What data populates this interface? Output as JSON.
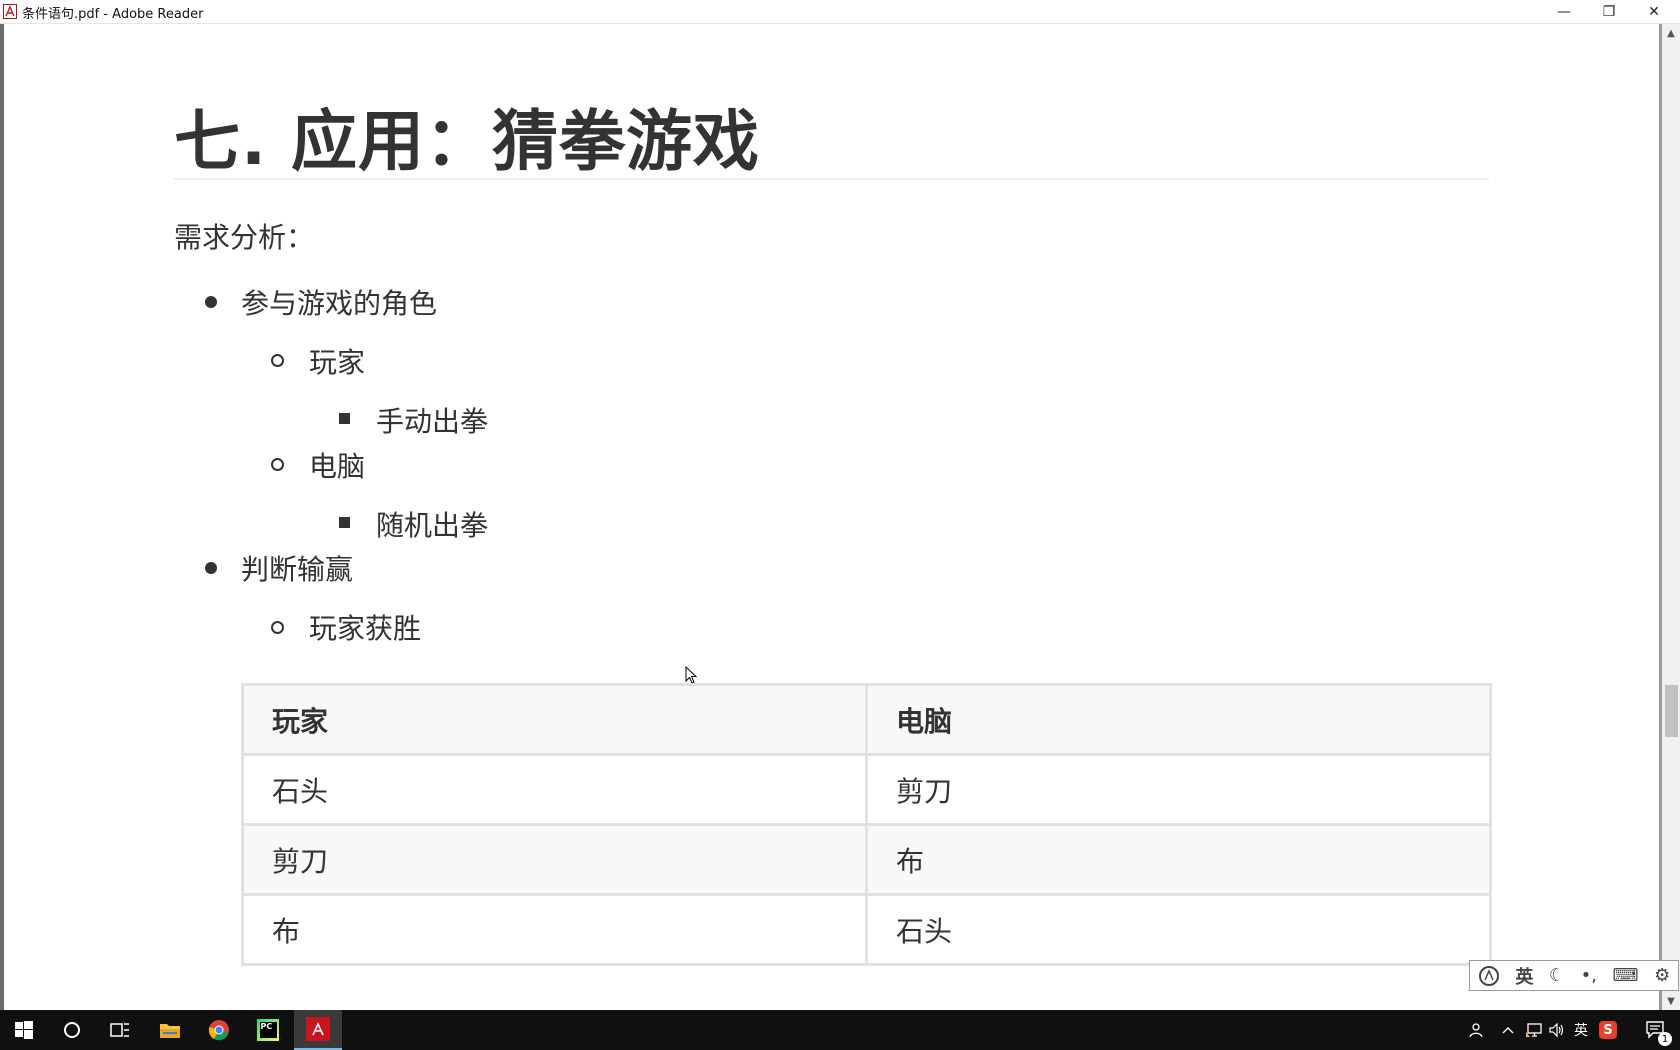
{
  "window": {
    "title": "条件语句.pdf - Adobe Reader",
    "controls": {
      "minimize": "—",
      "restore": "❐",
      "close": "✕"
    }
  },
  "document": {
    "heading": "七. 应用：猜拳游戏",
    "intro": "需求分析：",
    "list": {
      "roles": "参与游戏的角色",
      "player": "玩家",
      "player_action": "手动出拳",
      "computer": "电脑",
      "computer_action": "随机出拳",
      "judge": "判断输赢",
      "player_wins": "玩家获胜"
    },
    "table": {
      "headers": [
        "玩家",
        "电脑"
      ],
      "rows": [
        [
          "石头",
          "剪刀"
        ],
        [
          "剪刀",
          "布"
        ],
        [
          "布",
          "石头"
        ]
      ]
    }
  },
  "ime_toolbar": {
    "lang": "英",
    "icons": [
      "ime-logo-icon",
      "moon-icon",
      "punctuation-icon",
      "keyboard-icon",
      "gear-icon"
    ]
  },
  "taskbar": {
    "apps": [
      "start-icon",
      "search-icon",
      "task-view-icon",
      "file-explorer-icon",
      "chrome-icon",
      "pycharm-icon",
      "adobe-reader-icon"
    ],
    "pycharm_label": "PC",
    "tray_lang": "英",
    "notification_count": "1"
  },
  "colors": {
    "adobe_red": "#c8141e",
    "taskbar_bg": "#101010",
    "table_border": "#dfe2e5"
  }
}
